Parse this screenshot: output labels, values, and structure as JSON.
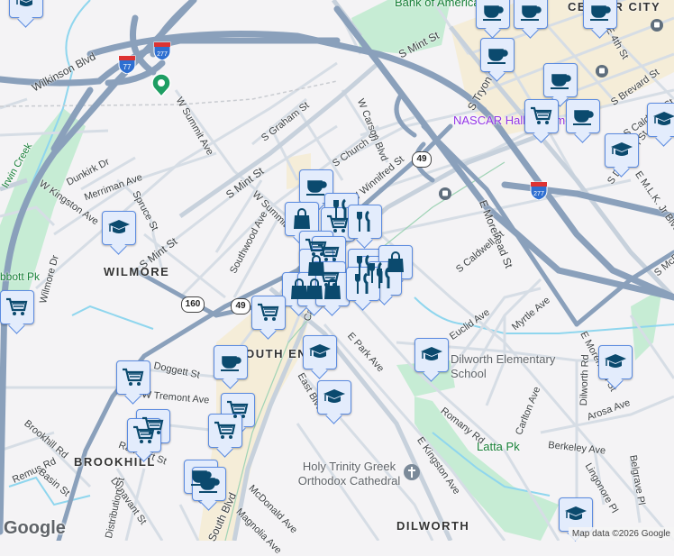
{
  "map": {
    "neighborhoods": [
      "WILMORE",
      "SOUTH END",
      "BROOKHILL",
      "DILWORTH",
      "CENTER CITY"
    ],
    "streets": [
      "Wilkinson Blvd",
      "W Summit Ave",
      "S Graham St",
      "S Mint St",
      "S Mint St",
      "S Mint St",
      "W Summit Ave",
      "Dunkirk Dr",
      "Merriman Ave",
      "W Kingston Ave",
      "Spruce St",
      "Southwood Ave",
      "S Church St",
      "W Carson Blvd",
      "W Winnifred St",
      "S Tryon St",
      "E 4th St",
      "S Brevard St",
      "S Caldwell St",
      "S Davidson St",
      "E M.L.K. Jr Blvd",
      "E Morehead St",
      "S Caldwell St",
      "S McDowell St",
      "Wilmore Dr",
      "Doggett St",
      "W Tremont Ave",
      "Brookhill Rd",
      "Remus Rd",
      "Basin St",
      "Dunavant St",
      "Distribution St",
      "South Blvd",
      "McDonald Ave",
      "Magnolia Ave",
      "Camden Rd",
      "East Blvd",
      "E Park Ave",
      "Euclid Ave",
      "Myrtle Ave",
      "Romany Rd",
      "Carlton Ave",
      "Berkeley Ave",
      "Dilworth Rd",
      "E Morehead St",
      "Arosa Ave",
      "Lingonore Pl",
      "Belgrave Pl",
      "E Kingston Ave",
      "Rampart St"
    ],
    "places": {
      "bank": "Bank of America",
      "nascar": "NASCAR Hall of Fame",
      "school": "Dilworth Elementary School",
      "park": "Latta Pk",
      "abbott": "Abbott Pk",
      "creek": "Irwin Creek",
      "cathedral": "Holy Trinity Greek Orthodox Cathedral"
    },
    "shields": {
      "i77": "77",
      "i277": "277",
      "i277b": "277",
      "r49": "49",
      "r49b": "49",
      "r160": "160"
    },
    "markers": [
      "coffee",
      "coffee",
      "coffee",
      "coffee",
      "coffee",
      "cart",
      "coffee",
      "school",
      "school",
      "school",
      "coffee",
      "shopping-bag",
      "restaurant",
      "cart",
      "restaurant",
      "cart",
      "cart",
      "shopping-bag",
      "restaurant",
      "restaurant",
      "shopping-bag",
      "restaurant",
      "cart",
      "shopping-bag",
      "shopping-bag",
      "shopping-bag",
      "restaurant",
      "cart",
      "school",
      "cart",
      "coffee",
      "school",
      "school",
      "school",
      "school",
      "cart",
      "cart",
      "cart",
      "cart",
      "cart",
      "coffee",
      "coffee",
      "school"
    ]
  },
  "footer": {
    "logo": "Google",
    "attribution": "Map data ©2026 Google"
  },
  "colors": {
    "highway": "#8aa0bb",
    "street": "#d3dae2",
    "park": "#c6ecd4",
    "water": "#8fd6ee",
    "marker_bg": "#e3ecfc",
    "marker_icon": "#0b4a6e",
    "downtown": "#f5edd8"
  }
}
